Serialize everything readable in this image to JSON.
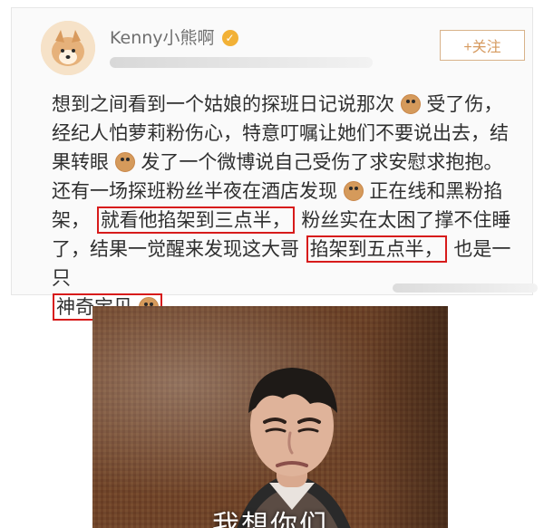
{
  "post": {
    "username": "Kenny小熊啊",
    "verified_icon": "verified-badge-icon",
    "follow_label": "+关注",
    "text_lines": [
      "想到之间看到一个姑娘的探班日记说那次",
      "受了伤，",
      "经纪人怕萝莉粉伤心，特意叮嘱让她们不要说出去，结",
      "果转眼",
      "发了一个微博说自己受伤了求安慰求抱抱。",
      "还有一场探班粉丝半夜在酒店发现",
      "正在线和黑粉掐",
      "架，",
      "就看他掐架到三点半，",
      "粉丝实在太困了撑不住睡",
      "了，结果一觉醒来发现这大哥",
      "掐架到五点半，",
      "也是一只",
      "神奇宝贝"
    ],
    "emoji_name": "doge-emoji-icon"
  },
  "meme": {
    "caption": "我想你们"
  }
}
